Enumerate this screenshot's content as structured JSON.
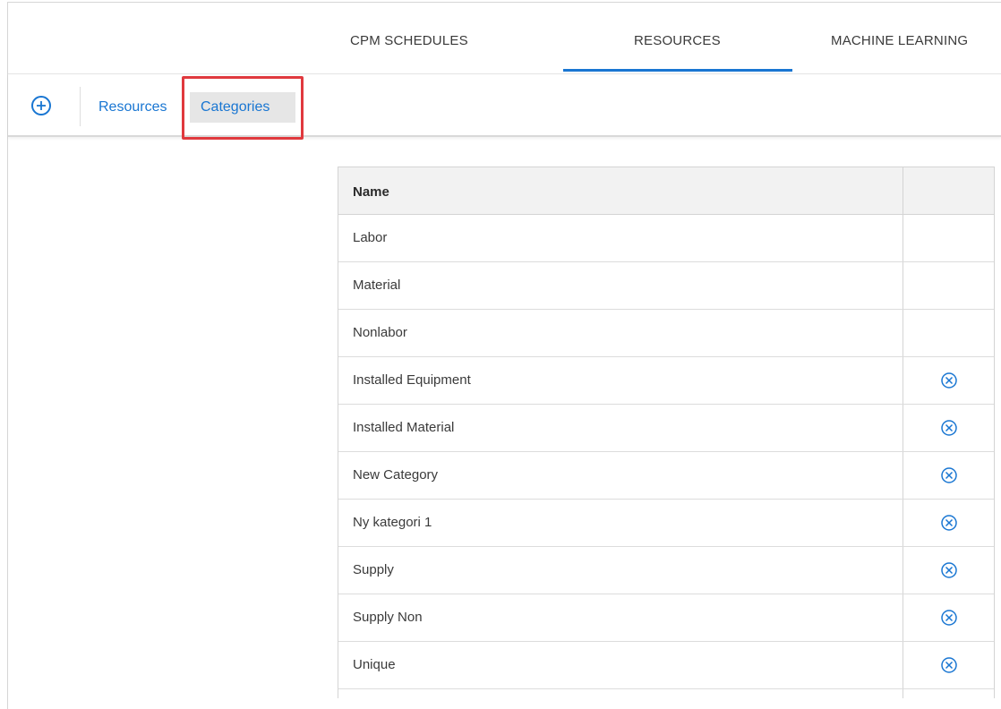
{
  "top_tabs": [
    {
      "label": "CPM SCHEDULES",
      "active": false
    },
    {
      "label": "RESOURCES",
      "active": true
    },
    {
      "label": "MACHINE LEARNING",
      "active": false
    }
  ],
  "toolbar": {
    "add_icon": "plus-circle-icon",
    "links": [
      {
        "label": "Resources",
        "active": false
      },
      {
        "label": "Categories",
        "active": true
      }
    ]
  },
  "colors": {
    "accent": "#1976d2",
    "highlight": "#e0393e",
    "header_bg": "#f2f2f2",
    "active_bg": "#e6e6e6"
  },
  "table": {
    "columns": [
      "Name",
      ""
    ],
    "rows": [
      {
        "name": "Labor",
        "removable": false
      },
      {
        "name": "Material",
        "removable": false
      },
      {
        "name": "Nonlabor",
        "removable": false
      },
      {
        "name": "Installed Equipment",
        "removable": true
      },
      {
        "name": "Installed Material",
        "removable": true
      },
      {
        "name": "New Category",
        "removable": true
      },
      {
        "name": "Ny kategori 1",
        "removable": true
      },
      {
        "name": "Supply",
        "removable": true
      },
      {
        "name": "Supply Non",
        "removable": true
      },
      {
        "name": "Unique",
        "removable": true
      }
    ],
    "remove_icon": "close-circle-icon"
  }
}
